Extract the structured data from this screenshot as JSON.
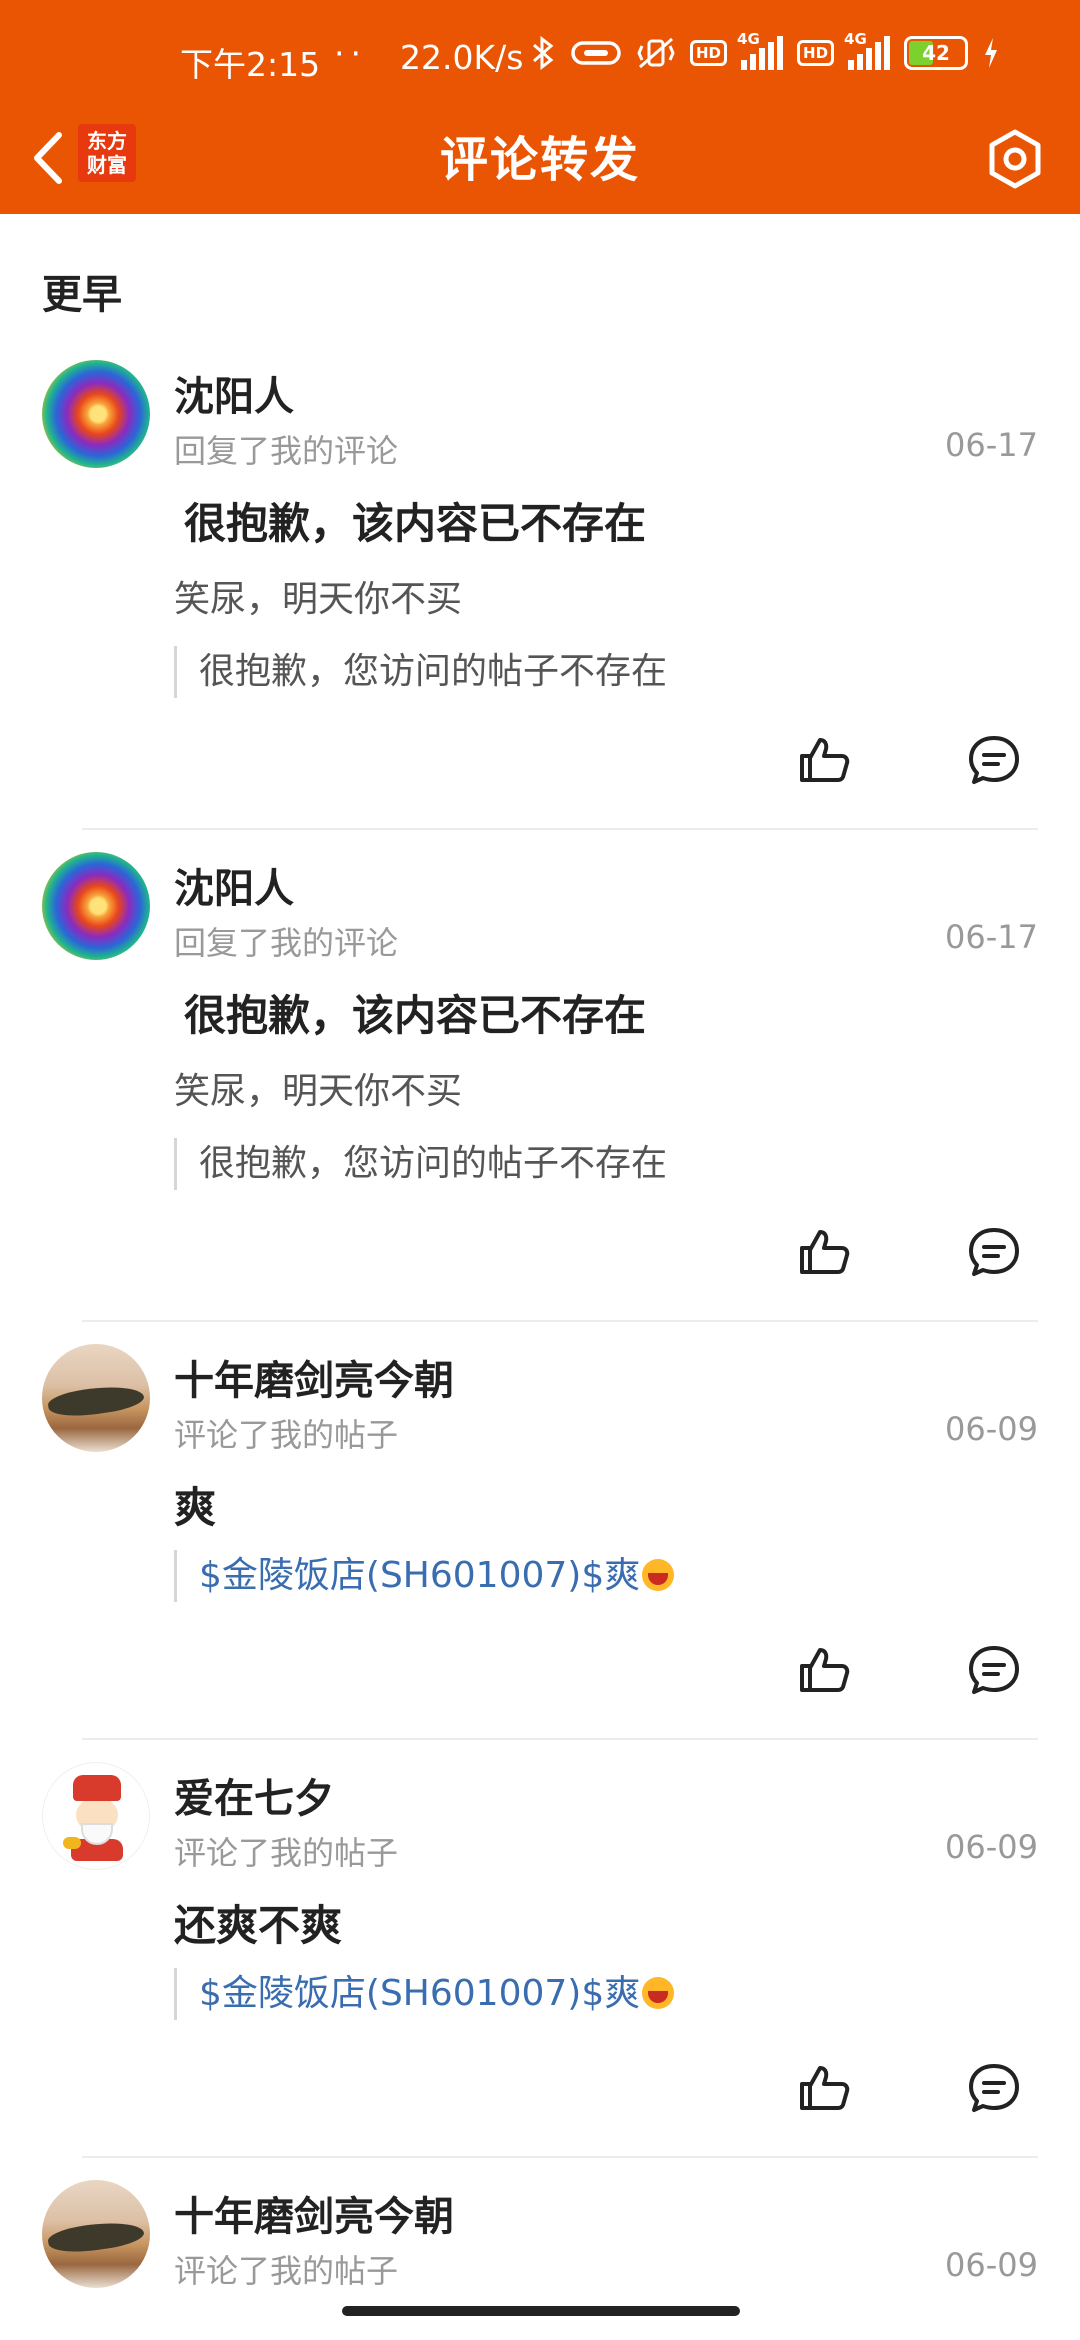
{
  "status_bar": {
    "time": "下午2:15",
    "dots": "··",
    "net_speed": "22.0K/s",
    "hd_label": "HD",
    "network_type": "4G",
    "battery_level": "42"
  },
  "header": {
    "logo_line1": "东方",
    "logo_line2": "财富",
    "title": "评论转发",
    "bg_color": "#EA5504"
  },
  "section": {
    "title": "更早"
  },
  "items": [
    {
      "avatar": "swirl-avatar",
      "username": "沈阳人",
      "action": "回复了我的评论",
      "date": "06-17",
      "headline": "很抱歉，该内容已不存在",
      "reply": "笑尿，明天你不买",
      "quote": "很抱歉，您访问的帖子不存在"
    },
    {
      "avatar": "swirl-avatar",
      "username": "沈阳人",
      "action": "回复了我的评论",
      "date": "06-17",
      "headline": "很抱歉，该内容已不存在",
      "reply": "笑尿，明天你不买",
      "quote": "很抱歉，您访问的帖子不存在"
    },
    {
      "avatar": "landscape-avatar",
      "username": "十年磨剑亮今朝",
      "action": "评论了我的帖子",
      "date": "06-09",
      "reply": "爽",
      "quote": "$金陵饭店(SH601007)$爽"
    },
    {
      "avatar": "god-of-wealth-avatar",
      "username": "爱在七夕",
      "action": "评论了我的帖子",
      "date": "06-09",
      "reply": "还爽不爽",
      "quote": "$金陵饭店(SH601007)$爽"
    },
    {
      "avatar": "landscape-avatar",
      "username": "十年磨剑亮今朝",
      "action": "评论了我的帖子",
      "date": "06-09"
    }
  ]
}
